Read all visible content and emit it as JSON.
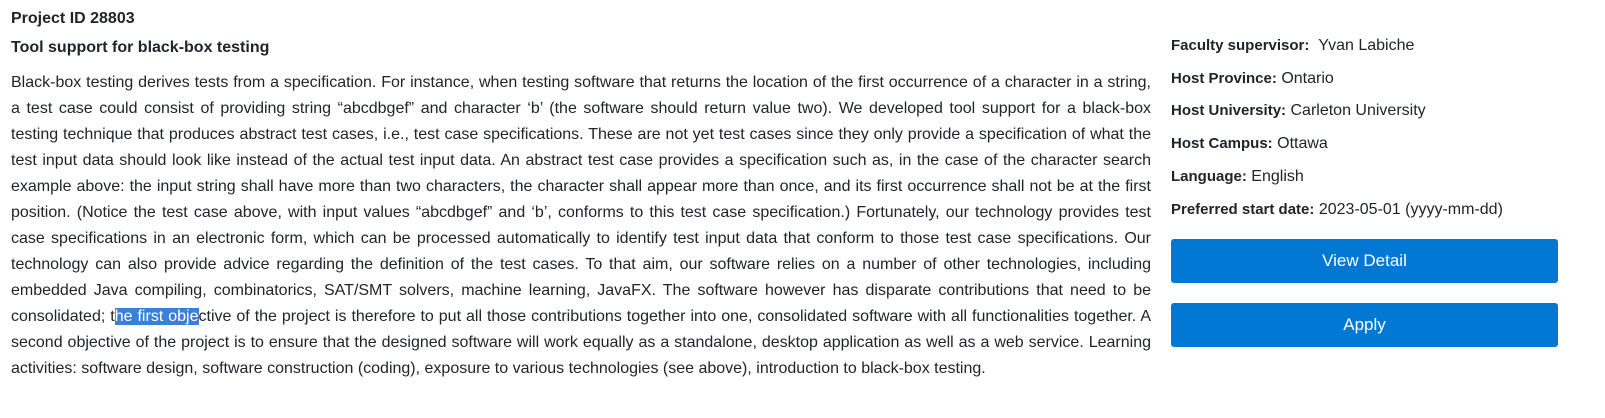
{
  "project": {
    "id_text": "Project ID 28803",
    "title": "Tool support for black-box testing",
    "description_before": "Black-box testing derives tests from a specification. For instance, when testing software that returns the location of the first occurrence of a character in a string, a test case could consist of providing string “abcdbgef” and character ‘b’ (the software should return value two). We developed tool support for a black-box testing technique that produces abstract test cases, i.e., test case specifications. These are not yet test cases since they only provide a specification of what the test input data should look like instead of the actual test input data. An abstract test case provides a specification such as, in the case of the character search example above: the input string shall have more than two characters, the character shall appear more than once, and its first occurrence shall not be at the first position. (Notice the test case above, with input values “abcdbgef” and ‘b’, conforms to this test case specification.) Fortunately, our technology provides test case specifications in an electronic form, which can be processed automatically to identify test input data that conform to those test case specifications. Our technology can also provide advice regarding the definition of the test cases. To that aim, our software relies on a number of other technologies, including embedded Java compiling, combinatorics, SAT/SMT solvers, machine learning, JavaFX. The software however has disparate contributions that need to be consolidated; t",
    "description_selected": "he first obje",
    "description_after": "ctive of the project is therefore to put all those contributions together into one, consolidated software with all functionalities together. A second objective of the project is to ensure that the designed software will work equally as a standalone, desktop application as well as a web service. Learning activities: software design, software construction (coding), exposure to various technologies (see above), introduction to black-box testing."
  },
  "details": {
    "supervisor_label": "Faculty supervisor:",
    "supervisor_value": "Yvan Labiche",
    "province_label": "Host Province:",
    "province_value": "Ontario",
    "university_label": "Host University:",
    "university_value": "Carleton University",
    "campus_label": "Host Campus:",
    "campus_value": "Ottawa",
    "language_label": "Language:",
    "language_value": "English",
    "start_label": "Preferred start date:",
    "start_value": "2023-05-01 (yyyy-mm-dd)"
  },
  "actions": {
    "view_detail_label": "View Detail",
    "apply_label": "Apply"
  },
  "colors": {
    "button_bg": "#0178d4",
    "selection_bg": "#3a80d9",
    "text": "#212529"
  }
}
